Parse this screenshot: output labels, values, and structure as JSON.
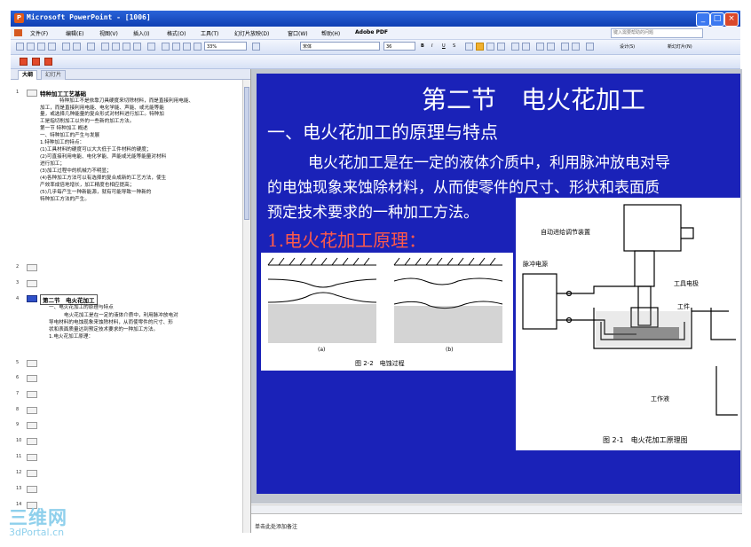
{
  "window": {
    "title": "Microsoft PowerPoint - [1006]",
    "app_icon": "powerpoint-icon",
    "controls": [
      "minimize-icon",
      "maximize-icon",
      "close-icon"
    ]
  },
  "menu": {
    "items": [
      "文件(F)",
      "编辑(E)",
      "视图(V)",
      "插入(I)",
      "格式(O)",
      "工具(T)",
      "幻灯片放映(D)",
      "窗口(W)",
      "帮助(H)",
      "Adobe PDF"
    ],
    "help_placeholder": "键入需要帮助的问题"
  },
  "toolbar": {
    "zoom": "33%",
    "font_name": "宋体",
    "font_size": "36",
    "design_label": "设计(S)",
    "new_slide_label": "新幻灯片(N)"
  },
  "outline": {
    "tabs": [
      "大纲",
      "幻灯片"
    ],
    "slides": [
      {
        "num": "1",
        "title": "特种加工工艺基础",
        "lines": [
          "特种加工不是依靠刀具硬度来切除材料，而是直接利用电能、",
          "加工，而是直接利用电能、电化学能、声能、或光能等能",
          "量，或选择几种能量的复合形式对材料进行加工。特种加",
          "工是指切削加工以外的一些新的加工方法。",
          "第一节 特种加工 概述",
          "一、特种加工的产生与发展",
          "1.特种加工的特点：",
          "(1)工具材料的硬度可以大大低于工件材料的硬度；",
          "(2)可直接利用电能、电化学能、声能或光能等能量对材料",
          "进行加工；",
          "(3)加工过程中的机械力不明显；",
          "(4)各种加工方法可以有选择的复合成新的工艺方法，使生",
          "产效率成倍地增长，加工精度也相应提高；",
          "(5)几乎每产生一种新能源，就有可能导致一种新的",
          "特种加工方法的产生。"
        ]
      },
      {
        "num": "2"
      },
      {
        "num": "3"
      },
      {
        "num": "4",
        "title": "第二节　电火花加工",
        "lines": [
          "一、电火花加工的原理与特点",
          "电火花加工是在一定的液体介质中，利用脉冲放电对",
          "导电材料的电蚀现象来蚀除材料，从而使零件的尺寸、形",
          "状和表面质量达到预定技术要求的一种加工方法。",
          "1.电火花加工原理："
        ]
      },
      {
        "num": "5"
      },
      {
        "num": "6"
      },
      {
        "num": "7"
      },
      {
        "num": "8"
      },
      {
        "num": "9"
      },
      {
        "num": "10"
      },
      {
        "num": "11"
      },
      {
        "num": "12"
      },
      {
        "num": "13"
      },
      {
        "num": "14"
      }
    ]
  },
  "slide": {
    "title": "第二节　电火花加工",
    "subtitle": "一、电火花加工的原理与特点",
    "body_lines": [
      "电火花加工是在一定的液体介质中，利用脉冲放电对导",
      "的电蚀现象来蚀除材料，从而使零件的尺寸、形状和表面质",
      "预定技术要求的一种加工方法。"
    ],
    "section": "1.电火花加工原理：",
    "fig2": {
      "label_a": "(a)",
      "label_b": "(b)",
      "caption": "图 2-2　电蚀过程"
    },
    "fig1": {
      "label_feed": "自动进给调节装置",
      "label_pulse": "脉冲电源",
      "label_tool": "工具电极",
      "label_work": "工件",
      "label_fluid": "工作液",
      "caption": "图 2-1　电火花加工原理图"
    }
  },
  "notes": {
    "placeholder": "单击此处添加备注"
  },
  "watermark": {
    "logo": "三维网",
    "url": "3dPortal.cn"
  }
}
